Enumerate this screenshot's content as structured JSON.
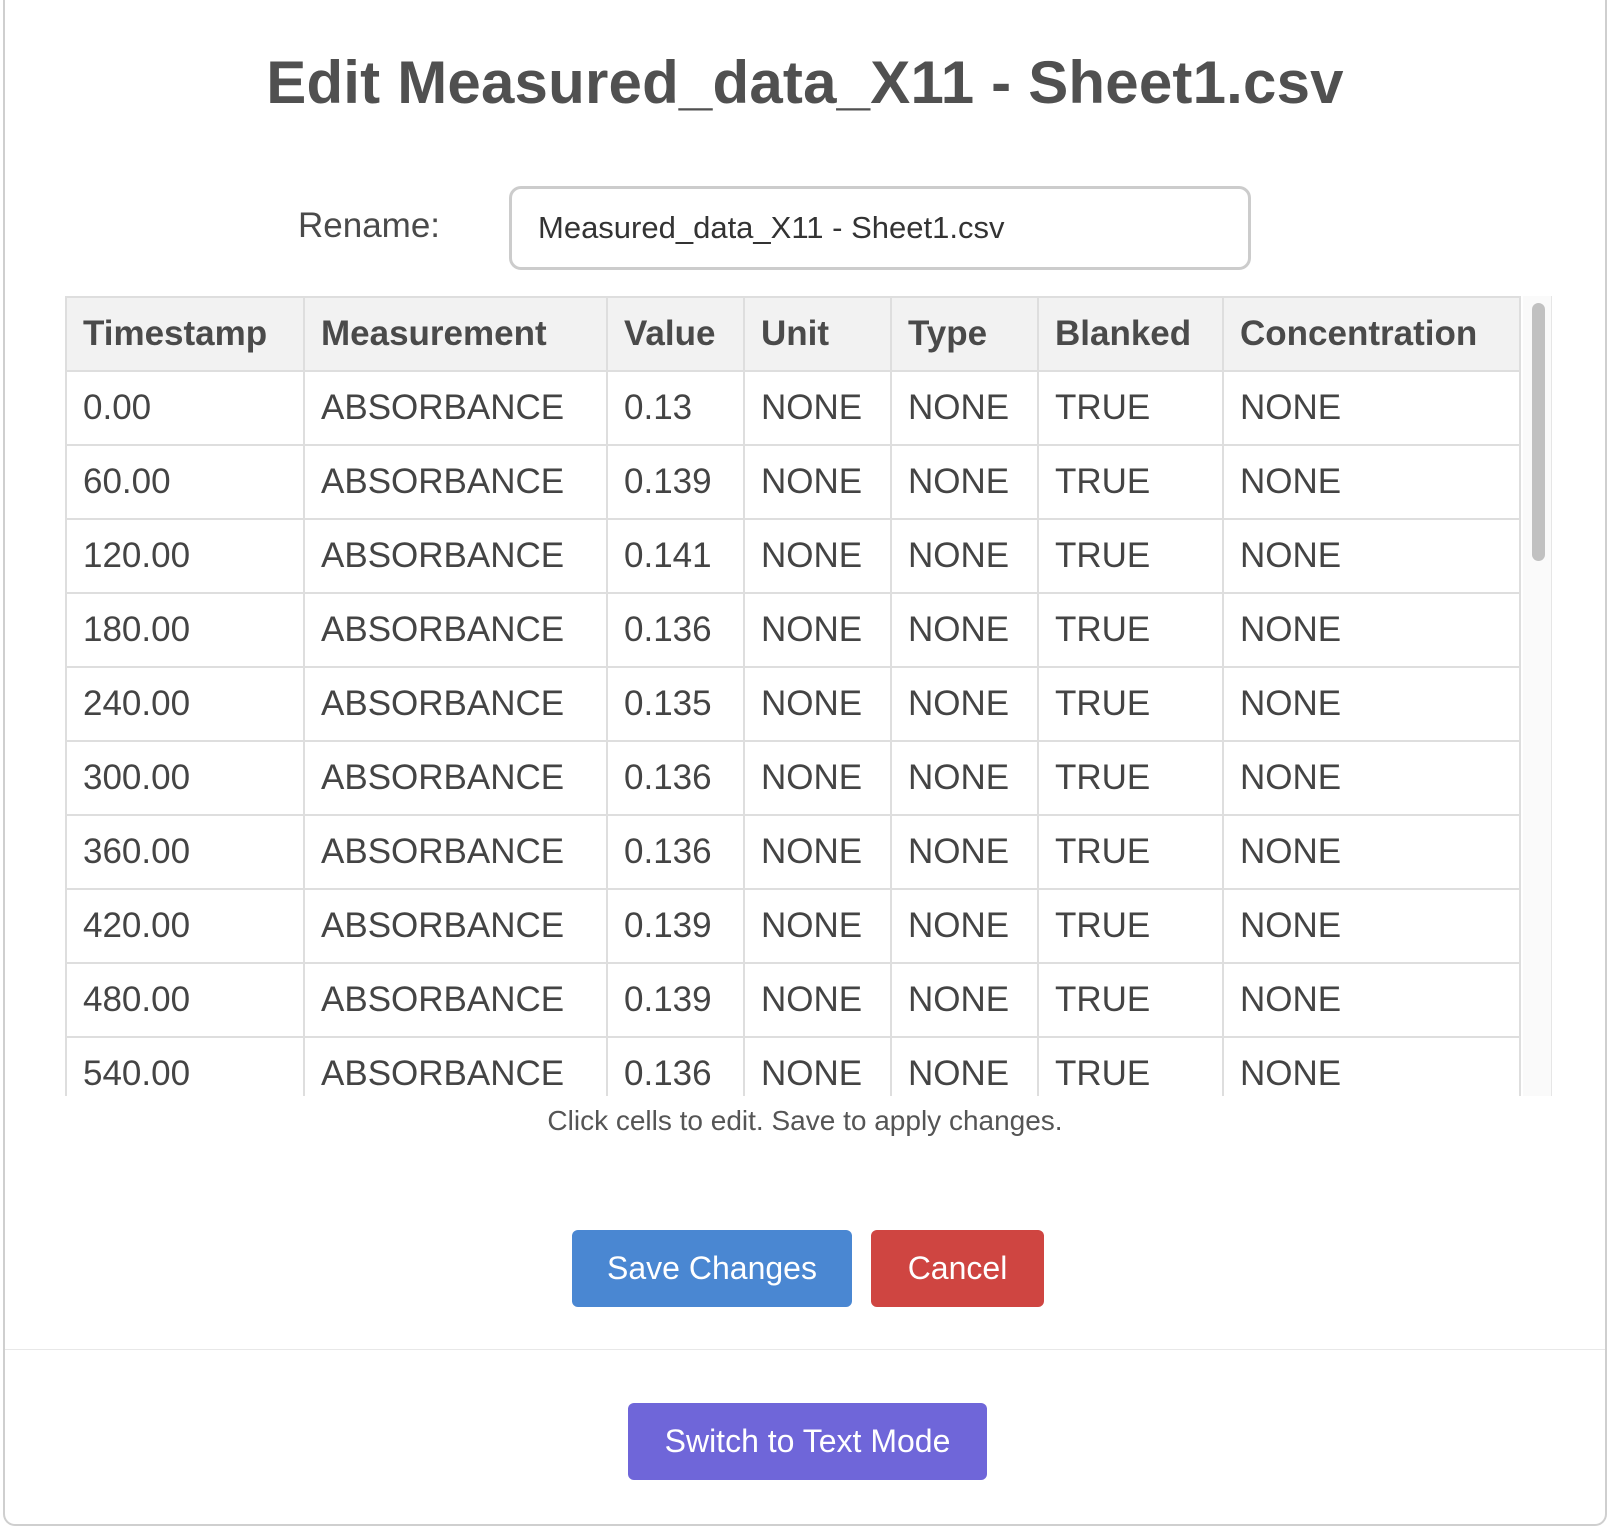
{
  "dialog": {
    "title": "Edit Measured_data_X11 - Sheet1.csv",
    "rename_label": "Rename:",
    "rename_value": "Measured_data_X11 - Sheet1.csv",
    "hint": "Click cells to edit. Save to apply changes.",
    "save_label": "Save Changes",
    "cancel_label": "Cancel",
    "switch_label": "Switch to Text Mode"
  },
  "table": {
    "columns": [
      "Timestamp",
      "Measurement",
      "Value",
      "Unit",
      "Type",
      "Blanked",
      "Concentration"
    ],
    "rows": [
      [
        "0.00",
        "ABSORBANCE",
        "0.13",
        "NONE",
        "NONE",
        "TRUE",
        "NONE"
      ],
      [
        "60.00",
        "ABSORBANCE",
        "0.139",
        "NONE",
        "NONE",
        "TRUE",
        "NONE"
      ],
      [
        "120.00",
        "ABSORBANCE",
        "0.141",
        "NONE",
        "NONE",
        "TRUE",
        "NONE"
      ],
      [
        "180.00",
        "ABSORBANCE",
        "0.136",
        "NONE",
        "NONE",
        "TRUE",
        "NONE"
      ],
      [
        "240.00",
        "ABSORBANCE",
        "0.135",
        "NONE",
        "NONE",
        "TRUE",
        "NONE"
      ],
      [
        "300.00",
        "ABSORBANCE",
        "0.136",
        "NONE",
        "NONE",
        "TRUE",
        "NONE"
      ],
      [
        "360.00",
        "ABSORBANCE",
        "0.136",
        "NONE",
        "NONE",
        "TRUE",
        "NONE"
      ],
      [
        "420.00",
        "ABSORBANCE",
        "0.139",
        "NONE",
        "NONE",
        "TRUE",
        "NONE"
      ],
      [
        "480.00",
        "ABSORBANCE",
        "0.139",
        "NONE",
        "NONE",
        "TRUE",
        "NONE"
      ],
      [
        "540.00",
        "ABSORBANCE",
        "0.136",
        "NONE",
        "NONE",
        "TRUE",
        "NONE"
      ]
    ]
  },
  "colors": {
    "save": "#4a87d2",
    "cancel": "#cf4541",
    "switch": "#6f66d9"
  }
}
